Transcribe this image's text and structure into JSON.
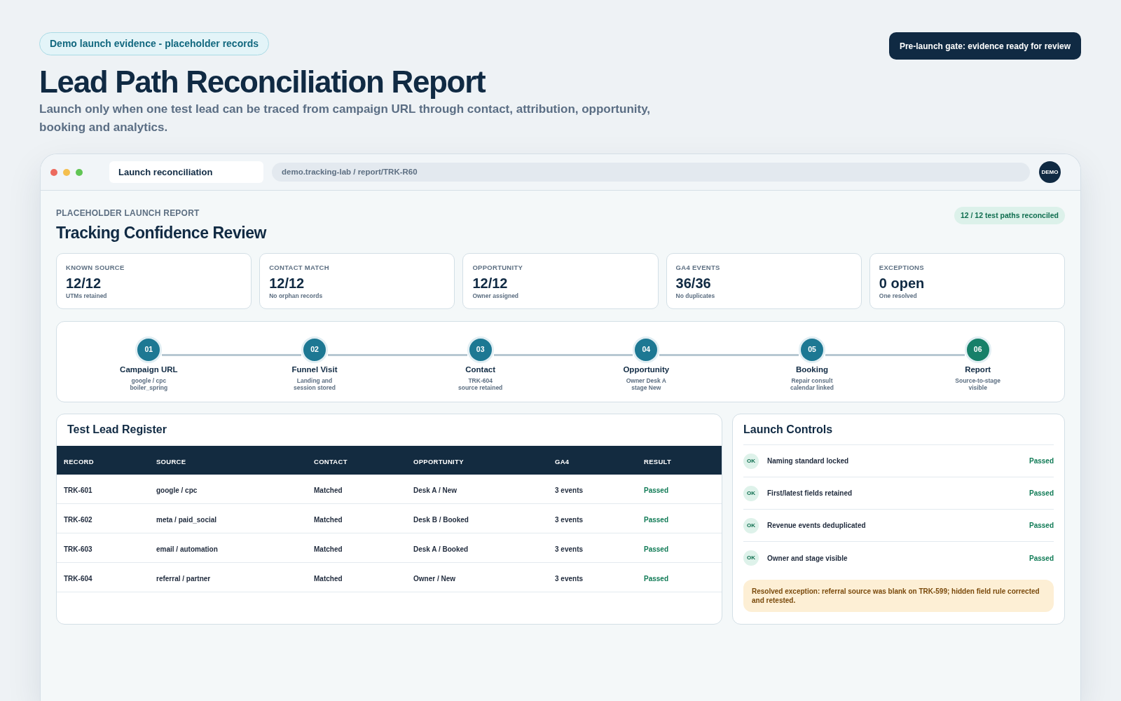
{
  "header": {
    "badge": "Demo launch evidence - placeholder records",
    "title": "Lead Path Reconciliation Report",
    "subtitle": "Launch only when one test lead can be traced from campaign URL through contact, attribution, opportunity, booking and analytics.",
    "gate_status": "Pre-launch gate: evidence ready for review"
  },
  "browser": {
    "tab": "Launch reconciliation",
    "url": "demo.tracking-lab / report/TRK-R60",
    "avatar": "DEMO"
  },
  "report": {
    "eyebrow": "PLACEHOLDER LAUNCH REPORT",
    "title": "Tracking Confidence Review",
    "status": "12 / 12 test paths reconciled"
  },
  "metrics": [
    {
      "label": "KNOWN SOURCE",
      "value": "12/12",
      "note": "UTMs retained"
    },
    {
      "label": "CONTACT MATCH",
      "value": "12/12",
      "note": "No orphan records"
    },
    {
      "label": "OPPORTUNITY",
      "value": "12/12",
      "note": "Owner assigned"
    },
    {
      "label": "GA4 EVENTS",
      "value": "36/36",
      "note": "No duplicates"
    },
    {
      "label": "EXCEPTIONS",
      "value": "0 open",
      "note": "One resolved"
    }
  ],
  "steps": [
    {
      "number": "01",
      "title": "Campaign URL",
      "detail_lines": [
        "google / cpc",
        "boiler_spring"
      ],
      "color": "#1d7893"
    },
    {
      "number": "02",
      "title": "Funnel Visit",
      "detail_lines": [
        "Landing and",
        "session stored"
      ],
      "color": "#1d7893"
    },
    {
      "number": "03",
      "title": "Contact",
      "detail_lines": [
        "TRK-604",
        "source retained"
      ],
      "color": "#1d7893"
    },
    {
      "number": "04",
      "title": "Opportunity",
      "detail_lines": [
        "Owner Desk A",
        "stage New"
      ],
      "color": "#1d7893"
    },
    {
      "number": "05",
      "title": "Booking",
      "detail_lines": [
        "Repair consult",
        "calendar linked"
      ],
      "color": "#1d7893"
    },
    {
      "number": "06",
      "title": "Report",
      "detail_lines": [
        "Source-to-stage",
        "visible"
      ],
      "color": "#178069"
    }
  ],
  "register": {
    "title": "Test Lead Register",
    "columns": [
      "RECORD",
      "SOURCE",
      "CONTACT",
      "OPPORTUNITY",
      "GA4",
      "RESULT"
    ],
    "rows": [
      {
        "record": "TRK-601",
        "source": "google / cpc",
        "contact": "Matched",
        "opportunity": "Desk A / New",
        "ga4": "3 events",
        "result": "Passed"
      },
      {
        "record": "TRK-602",
        "source": "meta / paid_social",
        "contact": "Matched",
        "opportunity": "Desk B / Booked",
        "ga4": "3 events",
        "result": "Passed"
      },
      {
        "record": "TRK-603",
        "source": "email / automation",
        "contact": "Matched",
        "opportunity": "Desk A / Booked",
        "ga4": "3 events",
        "result": "Passed"
      },
      {
        "record": "TRK-604",
        "source": "referral / partner",
        "contact": "Matched",
        "opportunity": "Owner / New",
        "ga4": "3 events",
        "result": "Passed"
      }
    ]
  },
  "controls": {
    "title": "Launch Controls",
    "items": [
      {
        "badge": "OK",
        "label": "Naming standard locked",
        "result": "Passed"
      },
      {
        "badge": "OK",
        "label": "First/latest fields retained",
        "result": "Passed"
      },
      {
        "badge": "OK",
        "label": "Revenue events deduplicated",
        "result": "Passed"
      },
      {
        "badge": "OK",
        "label": "Owner and stage visible",
        "result": "Passed"
      }
    ],
    "note": "Resolved exception: referral source was blank on TRK-599; hidden field rule corrected and retested."
  }
}
